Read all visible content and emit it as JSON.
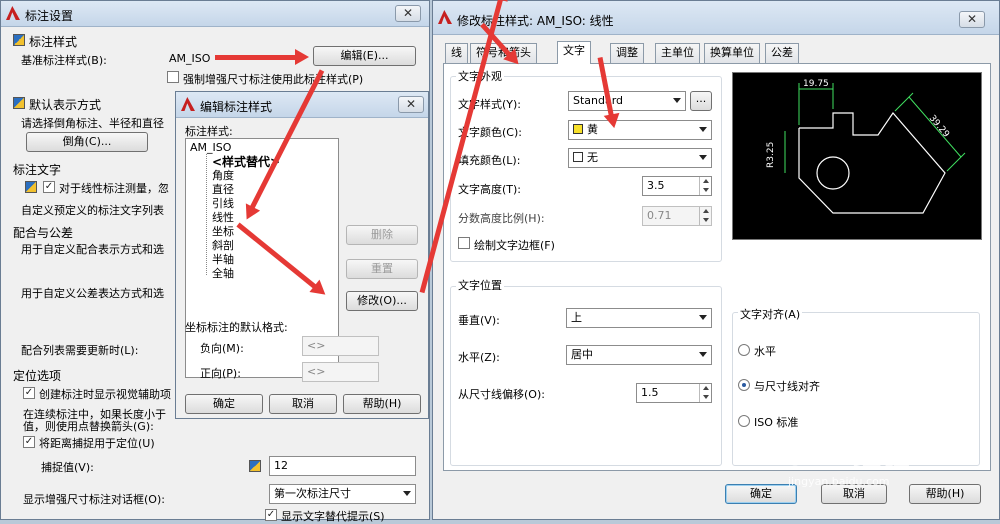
{
  "main": {
    "title": "标注设置",
    "close": "✕",
    "dim_style_header": "标注样式",
    "base_style_label": "基准标注样式(B):",
    "base_style_value": "AM_ISO",
    "edit_button": "编辑(E)...",
    "force_enhanced": "强制增强尺寸标注使用此标注样式(P)",
    "default_rep_header": "默认表示方式",
    "chamfer_prompt": "请选择倒角标注、半径和直径",
    "chamfer_button": "倒角(C)...",
    "text_header": "标注文字",
    "linear_prefix": "对于线性标注测量，忽",
    "custom_text": "自定义预定义的标注文字列表",
    "fit_header": "配合与公差",
    "fit_custom": "用于自定义配合表示方式和选",
    "tol_custom": "用于自定义公差表达方式和选",
    "fit_list_update": "配合列表需要更新时(L):",
    "position_header": "定位选项",
    "create_helper": "创建标注时显示视觉辅助项",
    "cont_line1": "在连续标注中，如果长度小于",
    "cont_line2": "值，则使用点替换箭头(G):",
    "snap_to_pos": "将距离捕捉用于定位(U)",
    "snap_value_label": "捕捉值(V):",
    "snap_value": "12",
    "show_dialog_label": "显示增强尺寸标注对话框(O):",
    "show_dialog_value": "第一次标注尺寸",
    "show_text_override": "显示文字替代提示(S)"
  },
  "edit_dialog": {
    "title": "编辑标注样式",
    "close": "✕",
    "styles_label": "标注样式:",
    "tree": [
      "AM_ISO",
      "<样式替代>",
      "角度",
      "直径",
      "引线",
      "线性",
      "坐标",
      "斜剖",
      "半轴",
      "全轴"
    ],
    "delete_button": "删除",
    "reset_button": "重置",
    "modify_button": "修改(O)...",
    "coord_default_label": "坐标标注的默认格式:",
    "negative_label": "负向(M):",
    "negative_value": "<>",
    "positive_label": "正向(P):",
    "positive_value": "<>",
    "ok_button": "确定",
    "cancel_button": "取消",
    "help_button": "帮助(H)"
  },
  "modify_dialog": {
    "title": "修改标注样式: AM_ISO: 线性",
    "close": "✕",
    "tabs": [
      "线",
      "符号和箭头",
      "文字",
      "调整",
      "主单位",
      "换算单位",
      "公差"
    ],
    "appearance_group": "文字外观",
    "text_style_label": "文字样式(Y):",
    "text_style_value": "Standard",
    "browse_button": "...",
    "text_color_label": "文字颜色(C):",
    "text_color_value": "黄",
    "fill_color_label": "填充颜色(L):",
    "fill_color_value": "无",
    "text_height_label": "文字高度(T):",
    "text_height_value": "3.5",
    "fraction_scale_label": "分数高度比例(H):",
    "fraction_scale_value": "0.71",
    "draw_frame_label": "绘制文字边框(F)",
    "placement_group": "文字位置",
    "vertical_label": "垂直(V):",
    "vertical_value": "上",
    "horizontal_label": "水平(Z):",
    "horizontal_value": "居中",
    "offset_label": "从尺寸线偏移(O):",
    "offset_value": "1.5",
    "alignment_group": "文字对齐(A)",
    "align_options": [
      "水平",
      "与尺寸线对齐",
      "ISO 标准"
    ],
    "align_selected": 1,
    "preview_dims": [
      "19.75",
      "R3.25",
      "39.29"
    ],
    "ok_button": "确定",
    "cancel_button": "取消",
    "help_button": "帮助(H)"
  },
  "colors": {
    "yellow": "#f7e02a",
    "preview_bg": "#000000",
    "dim_lines": "#40e060",
    "part_lines": "#ffffff",
    "arrow_red": "#e53935"
  },
  "watermark": {
    "brand": "Bai",
    "brand2": "经验",
    "site": "jingyan.baidu.com"
  }
}
